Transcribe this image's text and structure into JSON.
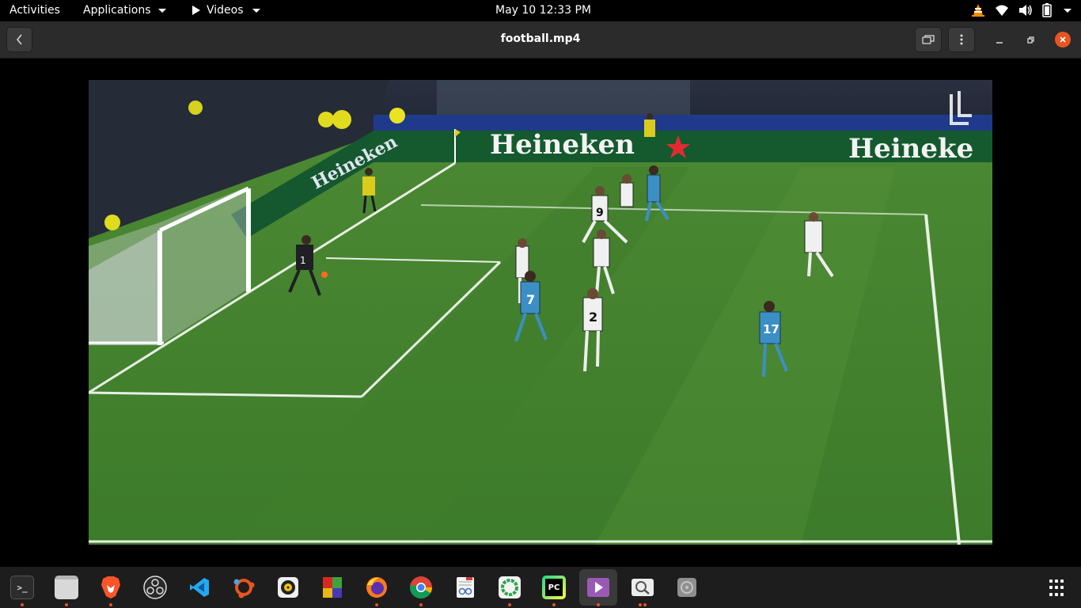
{
  "topbar": {
    "activities": "Activities",
    "applications": "Applications",
    "current_app": "Videos",
    "clock": "May 10  12:33 PM",
    "tray_icons": [
      "vlc-cone-icon",
      "wifi-icon",
      "volume-icon",
      "battery-icon",
      "chevron-down-icon"
    ]
  },
  "window": {
    "title": "football.mp4"
  },
  "video": {
    "ad_board_left": "Heineken",
    "ad_board_right": "Heineke",
    "ad_board_side": "Heineken",
    "jersey_numbers": [
      "7",
      "2",
      "17",
      "9",
      "1"
    ]
  },
  "dock": {
    "apps": [
      {
        "name": "terminal",
        "label": ">_"
      },
      {
        "name": "files",
        "label": ""
      },
      {
        "name": "brave",
        "label": ""
      },
      {
        "name": "obs",
        "label": ""
      },
      {
        "name": "vscode",
        "label": ""
      },
      {
        "name": "ubuntu-software",
        "label": ""
      },
      {
        "name": "rhythmbox",
        "label": ""
      },
      {
        "name": "office",
        "label": ""
      },
      {
        "name": "firefox",
        "label": ""
      },
      {
        "name": "chrome",
        "label": ""
      },
      {
        "name": "text-editor",
        "label": ""
      },
      {
        "name": "shutter",
        "label": ""
      },
      {
        "name": "pycharm",
        "label": "PC"
      },
      {
        "name": "videos",
        "label": ""
      },
      {
        "name": "image-viewer",
        "label": ""
      },
      {
        "name": "disk",
        "label": ""
      }
    ]
  }
}
